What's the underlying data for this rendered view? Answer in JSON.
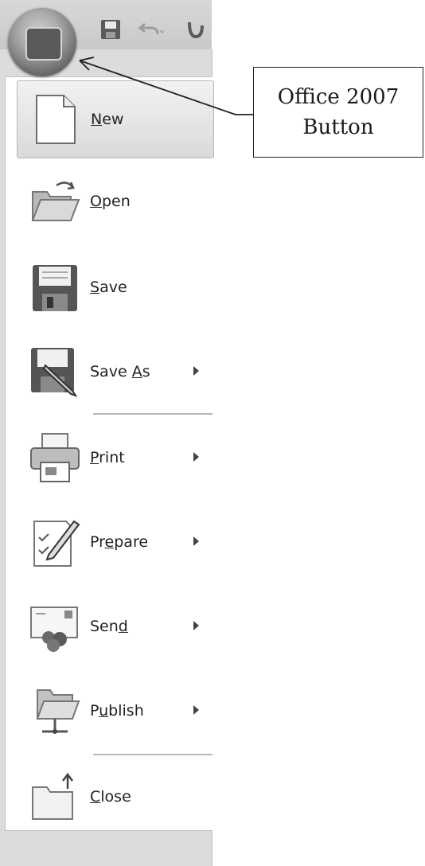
{
  "callout": {
    "line1": "Office 2007",
    "line2": "Button"
  },
  "quick_access": {
    "icons": [
      "save-icon",
      "undo-icon",
      "redo-icon"
    ]
  },
  "menu": {
    "items": [
      {
        "label_pre": "",
        "label_u": "N",
        "label_post": "ew",
        "icon": "new-document-icon",
        "submenu": false,
        "highlighted": true
      },
      {
        "label_pre": "",
        "label_u": "O",
        "label_post": "pen",
        "icon": "open-folder-icon",
        "submenu": false
      },
      {
        "label_pre": "",
        "label_u": "S",
        "label_post": "ave",
        "icon": "floppy-disk-icon",
        "submenu": false
      },
      {
        "label_pre": "Save ",
        "label_u": "A",
        "label_post": "s",
        "icon": "save-as-icon",
        "submenu": true
      },
      {
        "label_pre": "",
        "label_u": "P",
        "label_post": "rint",
        "icon": "printer-icon",
        "submenu": true
      },
      {
        "label_pre": "Pr",
        "label_u": "e",
        "label_post": "pare",
        "icon": "prepare-document-icon",
        "submenu": true
      },
      {
        "label_pre": "Sen",
        "label_u": "d",
        "label_post": "",
        "icon": "send-icon",
        "submenu": true
      },
      {
        "label_pre": "P",
        "label_u": "u",
        "label_post": "blish",
        "icon": "publish-icon",
        "submenu": true
      },
      {
        "label_pre": "",
        "label_u": "C",
        "label_post": "lose",
        "icon": "close-folder-icon",
        "submenu": false
      }
    ]
  }
}
